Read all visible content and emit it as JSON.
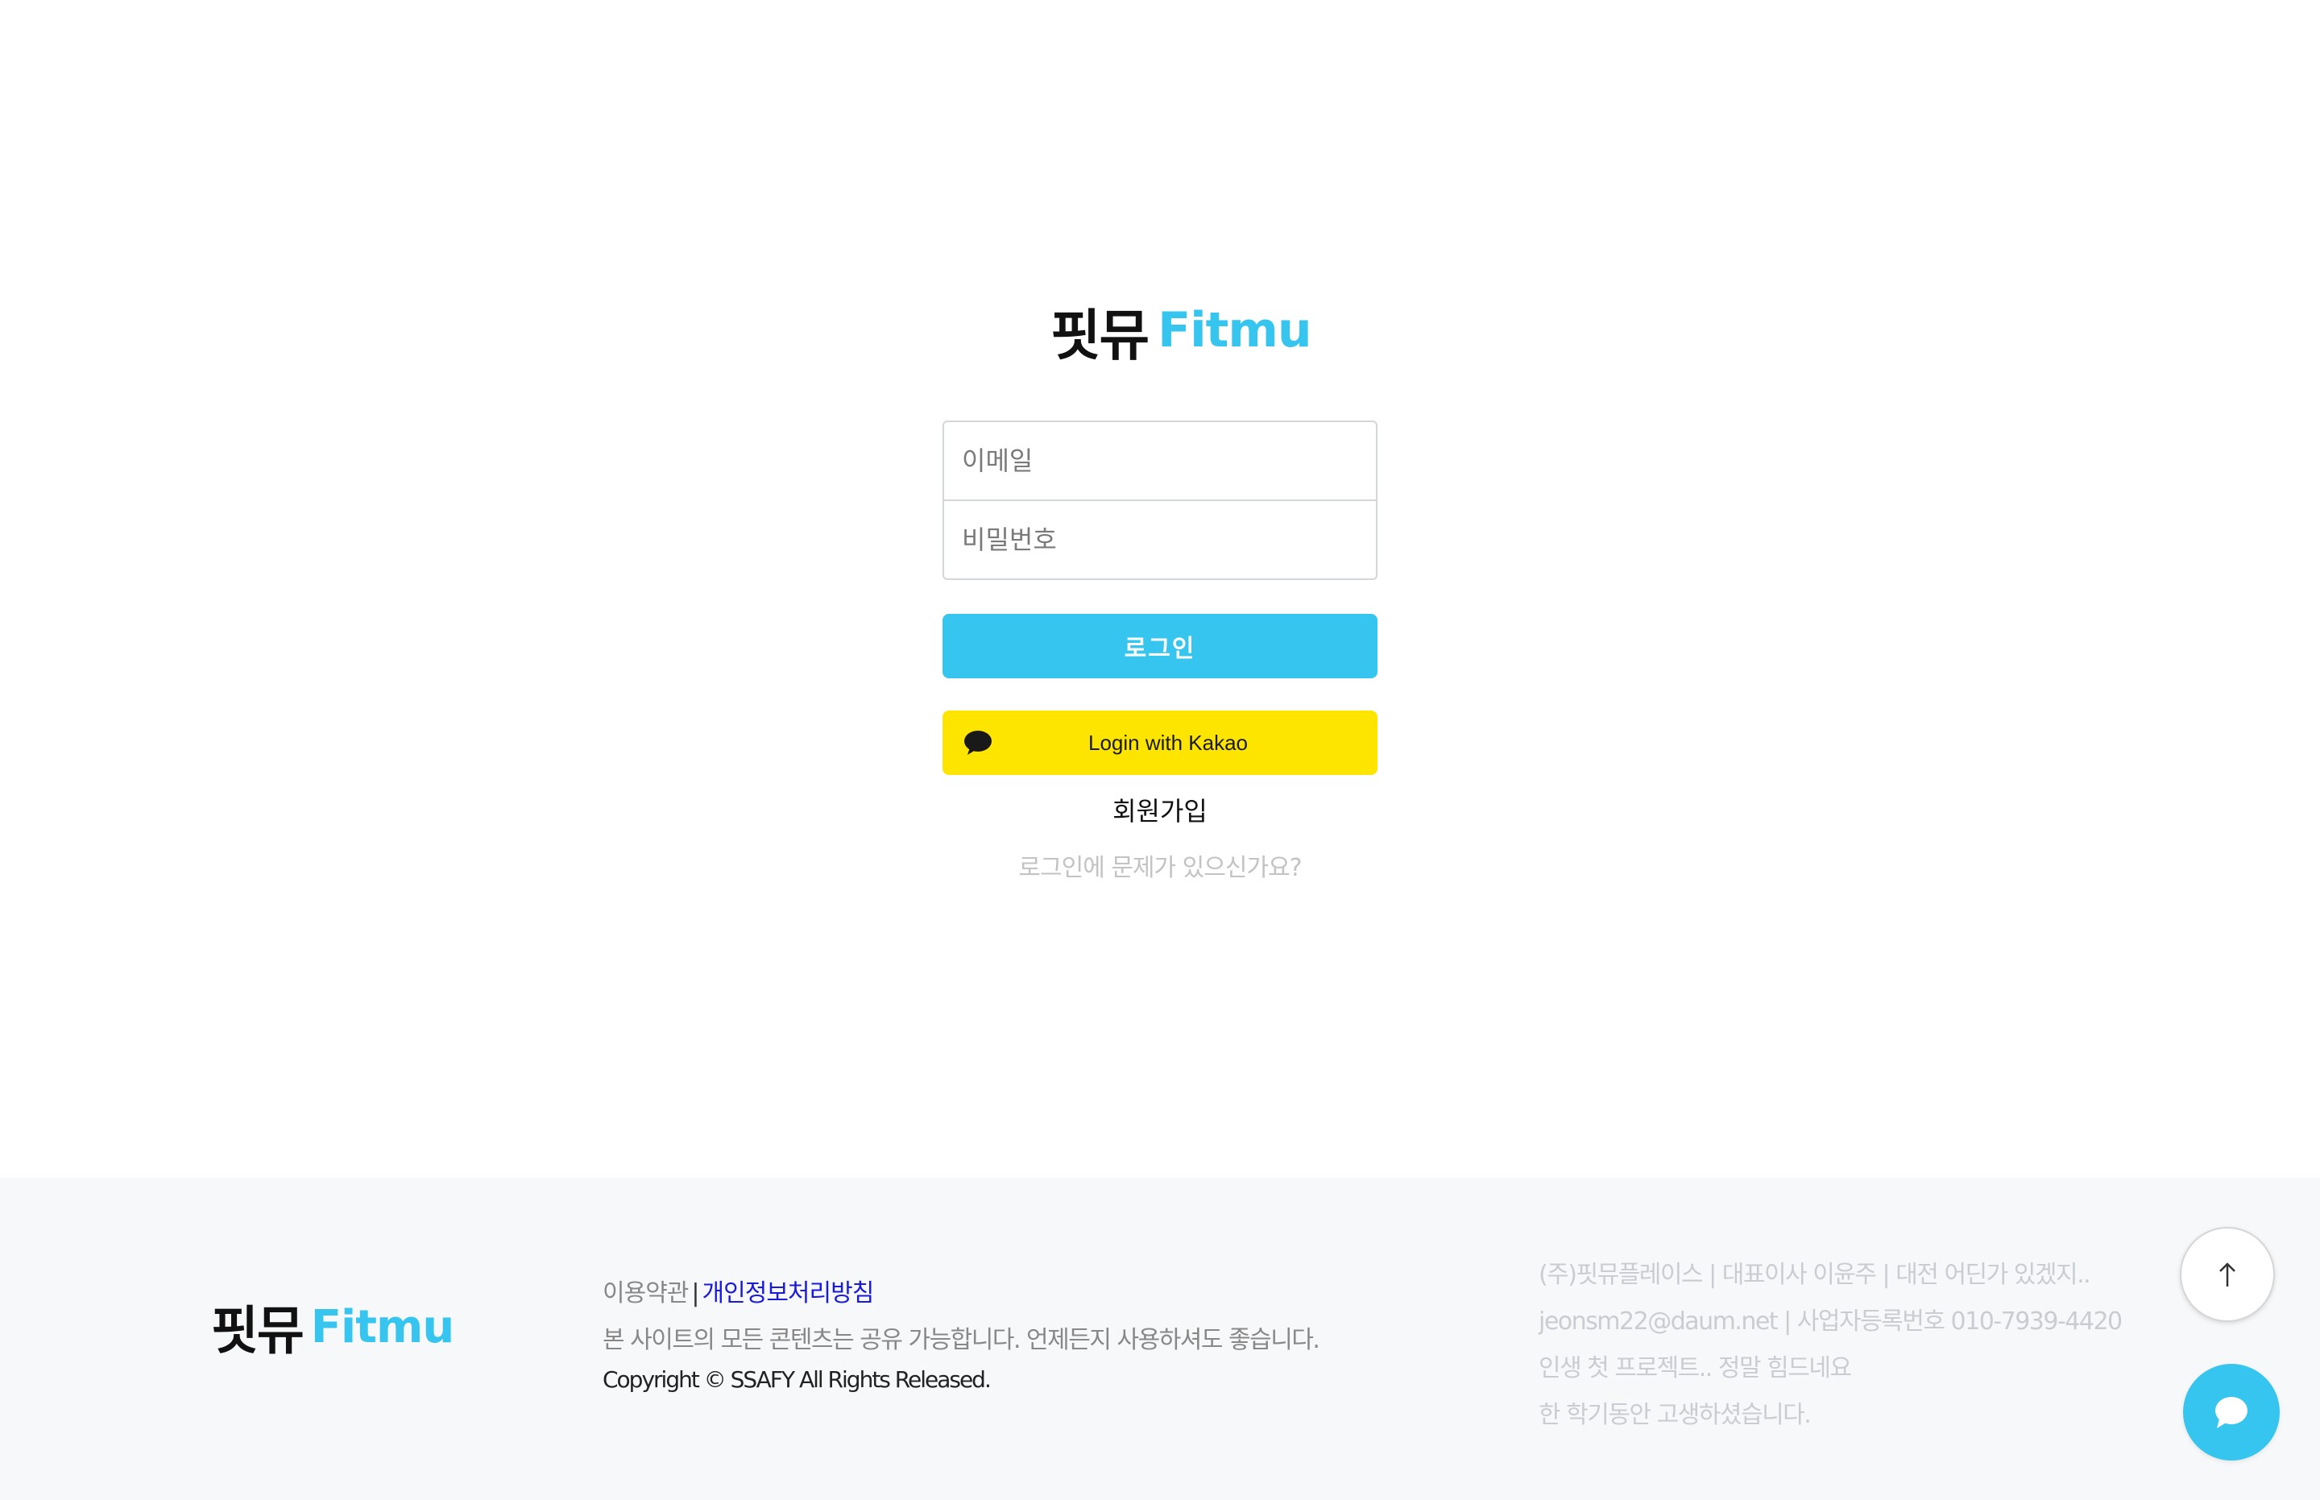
{
  "colors": {
    "brand_blue": "#35C5EE",
    "kakao_yellow": "#FEE500",
    "footer_bg": "#f7f8fa"
  },
  "logo": {
    "korean": "핏뮤",
    "english": "Fitmu"
  },
  "login_form": {
    "email_placeholder": "이메일",
    "password_placeholder": "비밀번호",
    "login_button": "로그인",
    "kakao_button": "Login with Kakao",
    "kakao_icon": "speech-bubble-icon",
    "signup_link": "회원가입",
    "trouble_link": "로그인에 문제가 있으신가요?"
  },
  "footer": {
    "terms_link": "이용약관",
    "separator": "|",
    "privacy_link": "개인정보처리방침",
    "description": "본 사이트의 모든 콘텐츠는 공유 가능합니다. 언제든지 사용하셔도 좋습니다.",
    "copyright": "Copyright © SSAFY All Rights Released.",
    "company_lines": [
      "(주)핏뮤플레이스 | 대표이사 이윤주 | 대전 어딘가 있겠지..",
      "jeonsm22@daum.net | 사업자등록번호 010-7939-4420",
      "인생 첫 프로젝트.. 정말 힘드네요",
      "한 학기동안 고생하셨습니다."
    ]
  },
  "floating_buttons": {
    "scroll_top_icon": "arrow-up-icon",
    "chat_icon": "chat-bubble-icon"
  }
}
